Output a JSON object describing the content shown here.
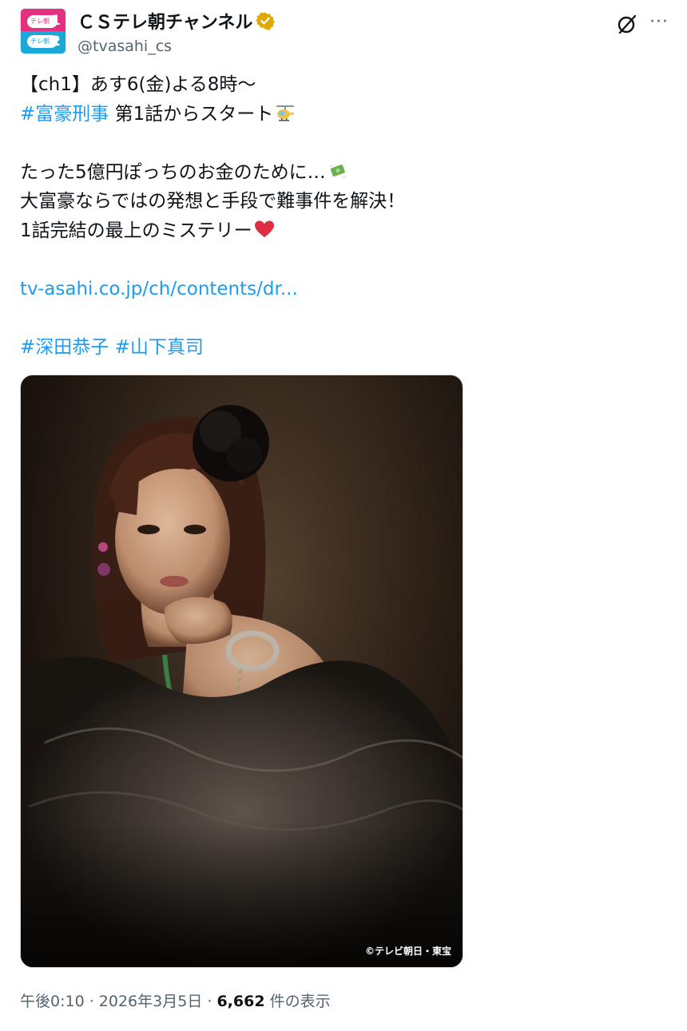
{
  "account": {
    "display_name": "ＣＳテレ朝チャンネル",
    "handle": "@tvasahi_cs",
    "avatar": {
      "badge_1": "テレ朝",
      "number_1": "1",
      "badge_2": "テレ朝",
      "number_2": "2"
    },
    "verified_icon": "verified-badge-icon",
    "verified_color": "#e0a800"
  },
  "header_actions": {
    "grok_icon": "grok-icon",
    "more_label": "···"
  },
  "tweet": {
    "line_1": "【ch1】あす6(金)よる8時～",
    "hashtag_1": "#富豪刑事",
    "line_2_rest": " 第1話からスタート",
    "line_2_emoji": "helicopter-emoji",
    "line_3": "たった5億円ぽっちのお金のために…",
    "line_3_emoji": "money-with-wings-emoji",
    "line_4": "大富豪ならではの発想と手段で難事件を解決！",
    "line_5": "1話完結の最上のミステリー",
    "line_5_emoji": "red-heart-emoji",
    "link": "tv-asahi.co.jp/ch/contents/dr...",
    "hashtag_2": "#深田恭子",
    "hashtag_3": "#山下真司"
  },
  "media": {
    "description_icon": "photo",
    "copyright": "©テレビ朝日・東宝"
  },
  "meta": {
    "time": "午後0:10",
    "separator_1": " · ",
    "date": "2026年3月5日",
    "separator_2": " · ",
    "views": "6,662",
    "views_label": " 件の表示"
  },
  "colors": {
    "link": "#1d9bf0",
    "text": "#0f1419",
    "secondary": "#536471"
  }
}
